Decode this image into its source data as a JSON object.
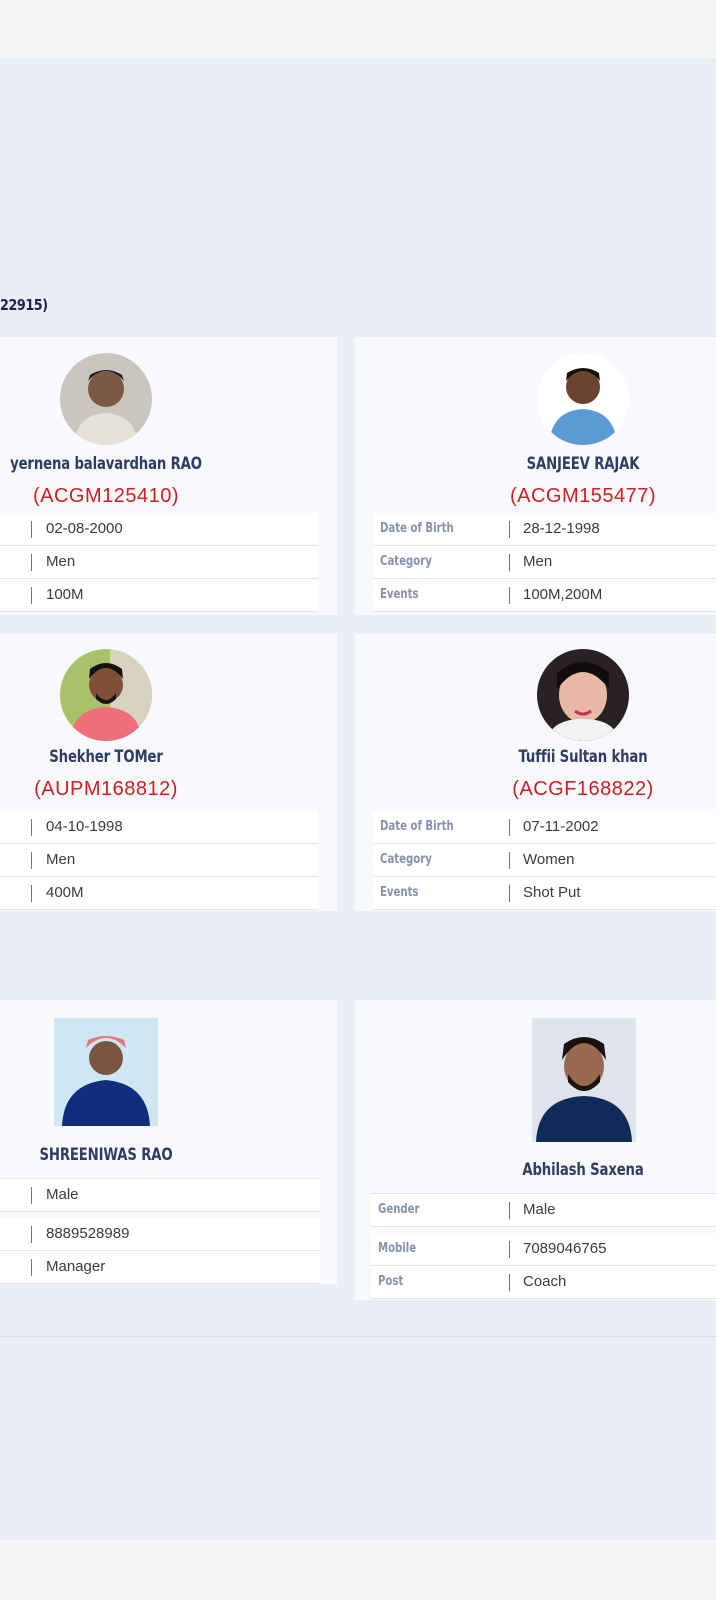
{
  "page": {
    "heading": "22915)",
    "colors": {
      "background": "#ebedf7",
      "card": "#f8f9fd",
      "name": "#2f3d62",
      "code": "#d11f1f"
    }
  },
  "labels": {
    "dob": "Date of Birth",
    "category": "Category",
    "events": "Events",
    "gender": "Gender",
    "mobile": "Mobile",
    "post": "Post"
  },
  "athletes": [
    {
      "name": "yernena balavardhan RAO",
      "code": "(ACGM125410)",
      "dob": "02-08-2000",
      "category": "Men",
      "events": "100M"
    },
    {
      "name": "SANJEEV RAJAK",
      "code": "(ACGM155477)",
      "dob": "28-12-1998",
      "category": "Men",
      "events": "100M,200M"
    },
    {
      "name": "Shekher TOMer",
      "code": "(AUPM168812)",
      "dob": "04-10-1998",
      "category": "Men",
      "events": "400M"
    },
    {
      "name": "Tuffii Sultan khan",
      "code": "(ACGF168822)",
      "dob": "07-11-2002",
      "category": "Women",
      "events": "Shot Put"
    }
  ],
  "officials": [
    {
      "name": "SHREENIWAS RAO",
      "gender": "Male",
      "mobile": "8889528989",
      "post": "Manager"
    },
    {
      "name": "Abhilash Saxena",
      "gender": "Male",
      "mobile": "7089046765",
      "post": "Coach"
    }
  ]
}
